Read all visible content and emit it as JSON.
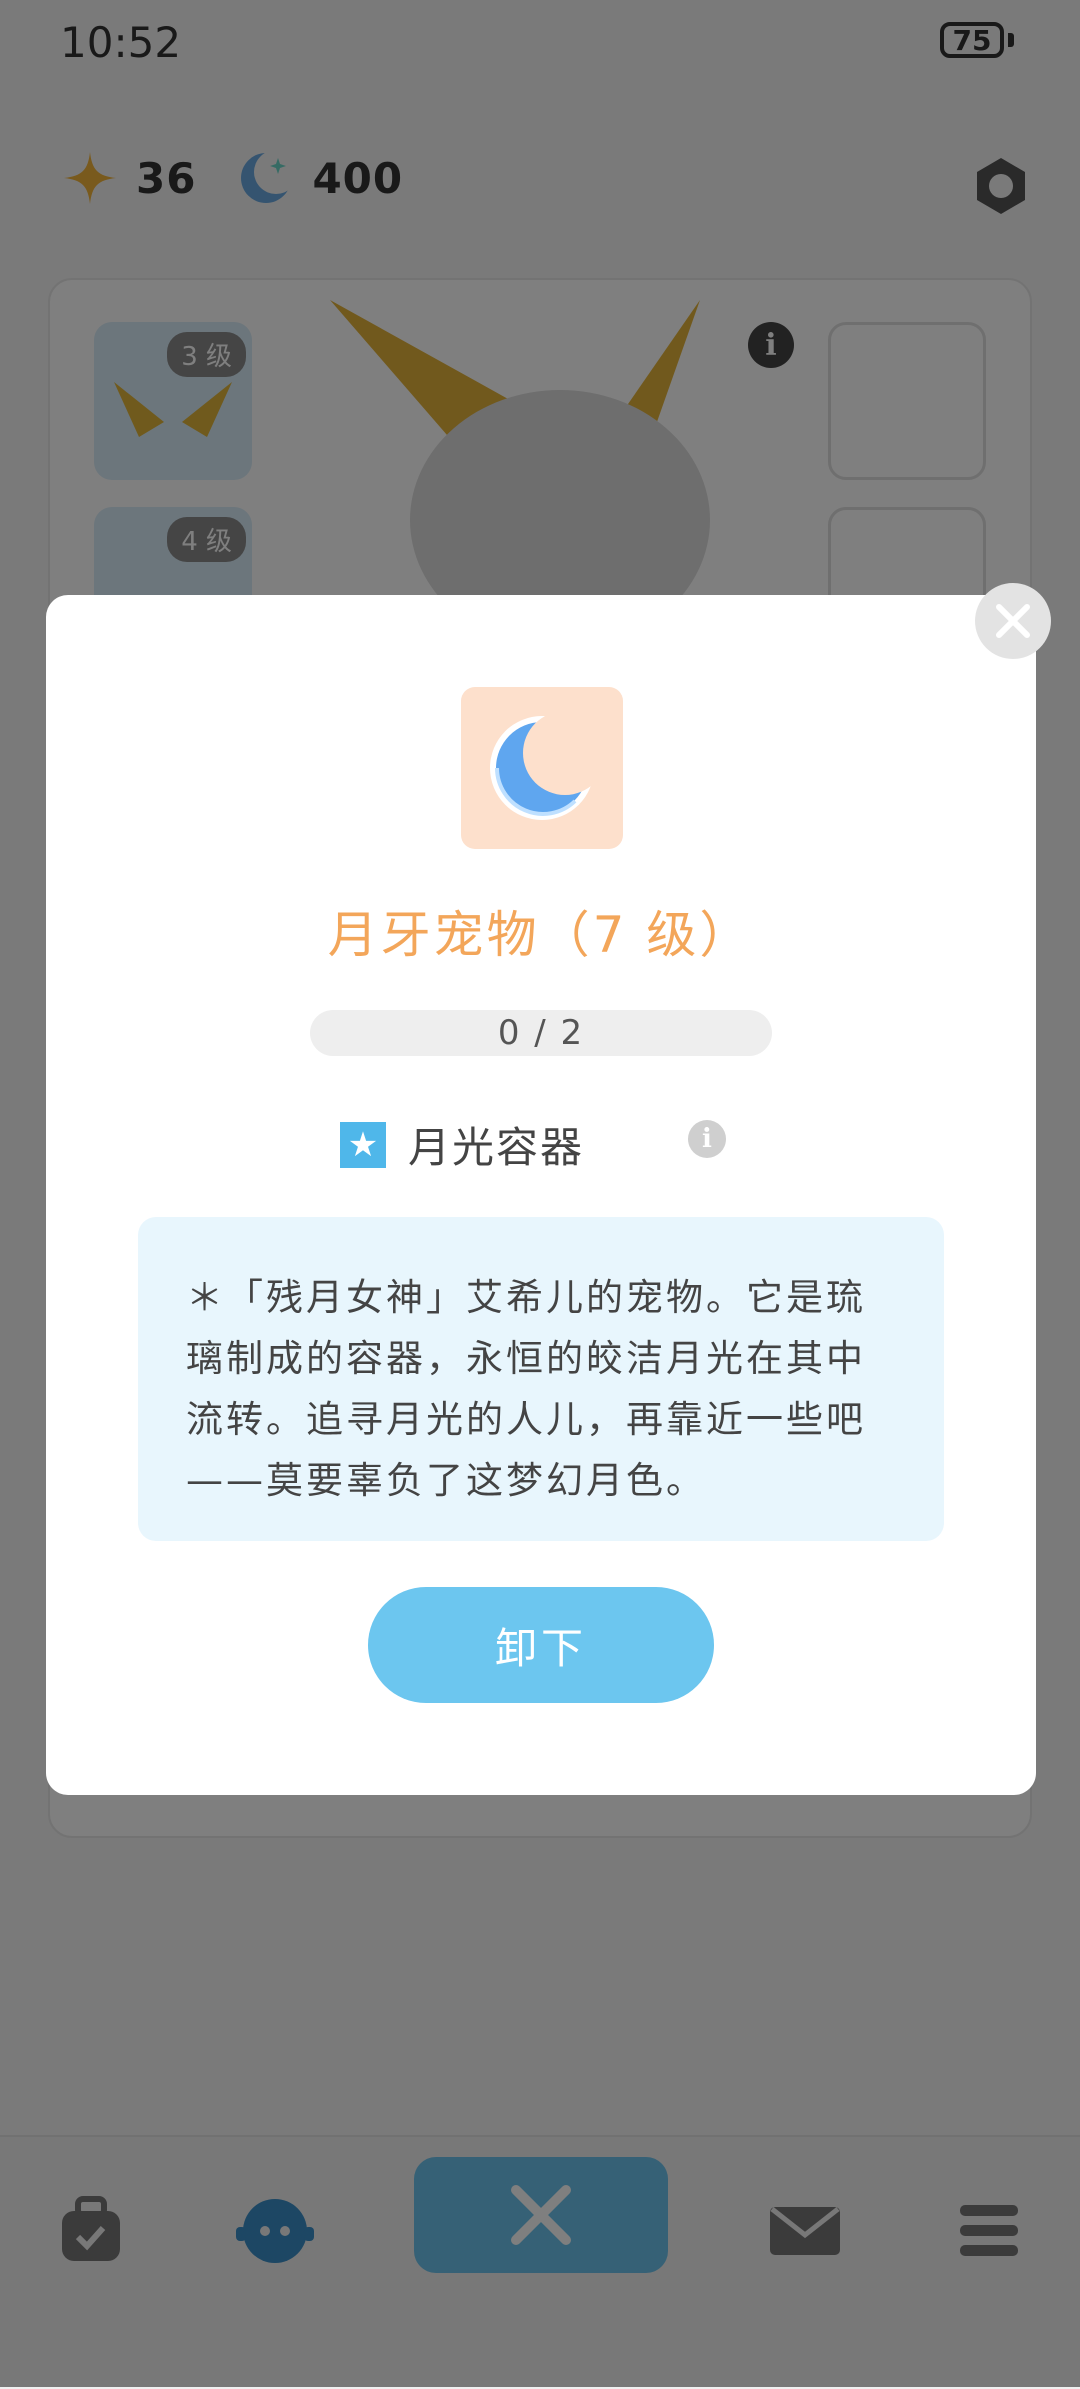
{
  "status_bar": {
    "time": "10:52",
    "battery": "75"
  },
  "currencies": [
    {
      "icon": "star-icon",
      "value": "36",
      "color": "#f2b43a"
    },
    {
      "icon": "moon-icon",
      "value": "400",
      "color": "#6aa9e0"
    }
  ],
  "wardrobe": {
    "slots": [
      {
        "level": "3 级"
      },
      {
        "level": "4 级"
      }
    ]
  },
  "bottom_nav": {
    "items": [
      "bag-icon",
      "character-icon",
      "swords-icon",
      "mail-icon",
      "menu-icon"
    ],
    "active_index": 2
  },
  "modal": {
    "title": "月牙宠物（7 级）",
    "progress": "0 / 2",
    "tag": "月光容器",
    "description": "＊「残月女神」艾希儿的宠物。它是琉璃制成的容器，永恒的皎洁月光在其中流转。追寻月光的人儿，再靠近一些吧——莫要辜负了这梦幻月色。",
    "action_label": "卸下",
    "accent_color": "#f3a65a",
    "button_color": "#6cc6ef"
  }
}
